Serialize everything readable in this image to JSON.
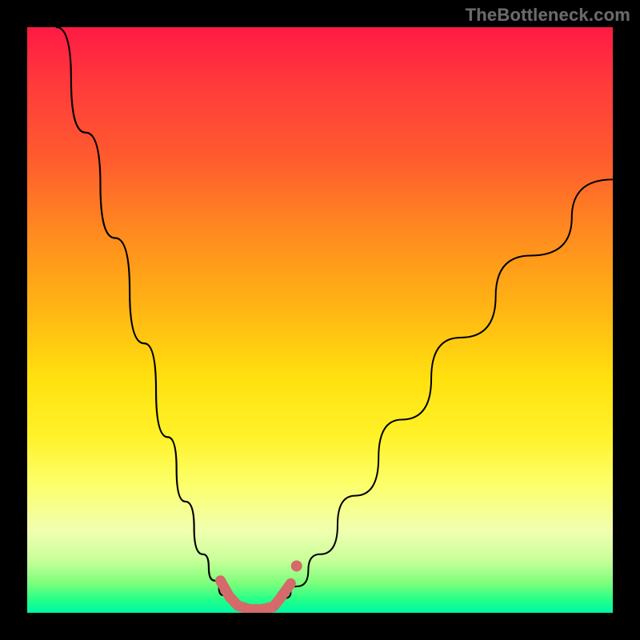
{
  "watermark": {
    "text": "TheBottleneck.com"
  },
  "chart_data": {
    "type": "line",
    "title": "",
    "xlabel": "",
    "ylabel": "",
    "xlim": [
      0,
      1
    ],
    "ylim": [
      0,
      1
    ],
    "annotations": [],
    "series": [
      {
        "name": "curve-left",
        "color": "#000000",
        "x": [
          0.05,
          0.1,
          0.15,
          0.2,
          0.24,
          0.27,
          0.3,
          0.32,
          0.335,
          0.345
        ],
        "y": [
          1.0,
          0.82,
          0.64,
          0.46,
          0.3,
          0.19,
          0.1,
          0.055,
          0.03,
          0.02
        ]
      },
      {
        "name": "curve-right",
        "color": "#000000",
        "x": [
          0.44,
          0.46,
          0.5,
          0.56,
          0.64,
          0.74,
          0.86,
          1.0
        ],
        "y": [
          0.025,
          0.045,
          0.1,
          0.2,
          0.33,
          0.47,
          0.61,
          0.74
        ]
      },
      {
        "name": "valley-marker",
        "color": "#d46a6a",
        "x": [
          0.33,
          0.345,
          0.36,
          0.38,
          0.4,
          0.42,
          0.43,
          0.45
        ],
        "y": [
          0.055,
          0.028,
          0.012,
          0.006,
          0.006,
          0.01,
          0.022,
          0.05
        ]
      },
      {
        "name": "valley-dot",
        "color": "#d46a6a",
        "x": [
          0.46
        ],
        "y": [
          0.08
        ]
      }
    ]
  }
}
